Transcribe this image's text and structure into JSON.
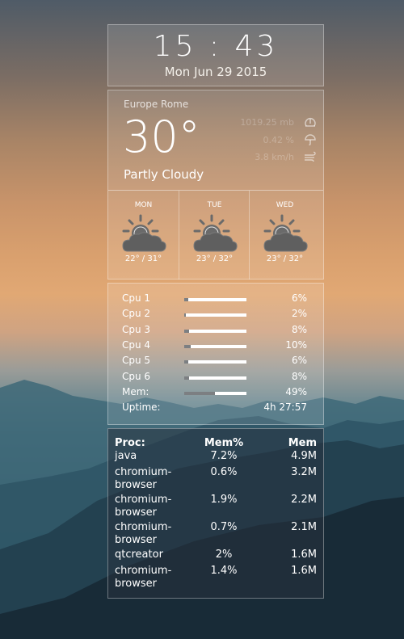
{
  "clock": {
    "time": "15 : 43",
    "date": "Mon Jun 29 2015"
  },
  "weather": {
    "location": "Europe Rome",
    "temperature": "30°",
    "condition": "Partly Cloudy",
    "pressure": "1019.25 mb",
    "precipitation": "0.42 %",
    "wind": "3.8 km/h",
    "forecast": [
      {
        "day": "MON",
        "range": "22° / 31°",
        "icon": "partly-cloudy-icon"
      },
      {
        "day": "TUE",
        "range": "23° / 32°",
        "icon": "partly-cloudy-icon"
      },
      {
        "day": "WED",
        "range": "23° / 32°",
        "icon": "partly-cloudy-icon"
      }
    ]
  },
  "system": {
    "rows": [
      {
        "label": "Cpu 1",
        "value": "6%",
        "fraction": 0.06
      },
      {
        "label": "Cpu 2",
        "value": "2%",
        "fraction": 0.02
      },
      {
        "label": "Cpu 3",
        "value": "8%",
        "fraction": 0.08
      },
      {
        "label": "Cpu 4",
        "value": "10%",
        "fraction": 0.1
      },
      {
        "label": "Cpu 5",
        "value": "6%",
        "fraction": 0.06
      },
      {
        "label": "Cpu 6",
        "value": "8%",
        "fraction": 0.08
      },
      {
        "label": "Mem:",
        "value": "49%",
        "fraction": 0.49
      }
    ],
    "uptime_label": "Uptime:",
    "uptime_value": "4h 27:57"
  },
  "processes": {
    "headers": [
      "Proc:",
      "Mem%",
      "Mem"
    ],
    "rows": [
      [
        "java",
        "7.2%",
        "4.9M"
      ],
      [
        "chromium-browser",
        "0.6%",
        "3.2M"
      ],
      [
        "chromium-browser",
        "1.9%",
        "2.2M"
      ],
      [
        "chromium-browser",
        "0.7%",
        "2.1M"
      ],
      [
        "qtcreator",
        "2%",
        "1.6M"
      ],
      [
        "chromium-browser",
        "1.4%",
        "1.6M"
      ]
    ]
  }
}
